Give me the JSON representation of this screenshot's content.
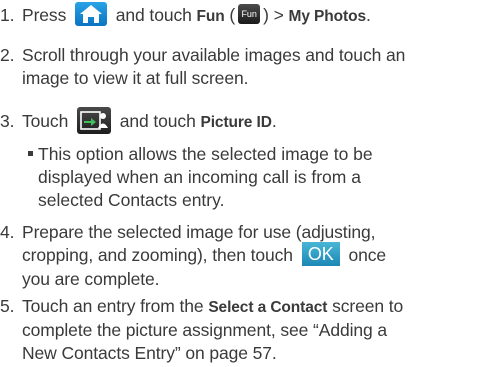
{
  "steps": [
    {
      "number": "1.",
      "text_a": "Press",
      "text_b": "and touch",
      "fun_label": "Fun",
      "paren_open": "(",
      "fun_icon_label": "Fun",
      "paren_close": ")",
      "arrow": ">",
      "my_photos": "My Photos",
      "period": "."
    },
    {
      "number": "2.",
      "line1": "Scroll through your available images and touch an",
      "line2": "image to view it at full screen."
    },
    {
      "number": "3.",
      "text_a": "Touch",
      "text_b": "and touch",
      "picture_id": "Picture ID",
      "period": "."
    },
    {
      "bullet_line1": "This option allows the selected image to be",
      "bullet_line2": "displayed when an incoming call is from a",
      "bullet_line3": "selected Contacts entry."
    },
    {
      "number": "4.",
      "line1": "Prepare the selected image for use (adjusting,",
      "line2_a": "cropping, and zooming), then touch",
      "ok_label": "OK",
      "line2_b": "once",
      "line3": "you are complete."
    },
    {
      "number": "5.",
      "line1_a": "Touch an entry from the",
      "select_contact": "Select a Contact",
      "line1_b": "screen to",
      "line2": "complete the picture assignment, see “Adding a",
      "line3": "New Contacts Entry” on page 57."
    }
  ],
  "icons": {
    "home": "home-icon",
    "fun": "fun-icon",
    "menu": "menu-icon"
  },
  "colors": {
    "text": "#3a3a3a",
    "home_icon": "#1a8fd8",
    "ok_button": "#2ea0c8"
  }
}
